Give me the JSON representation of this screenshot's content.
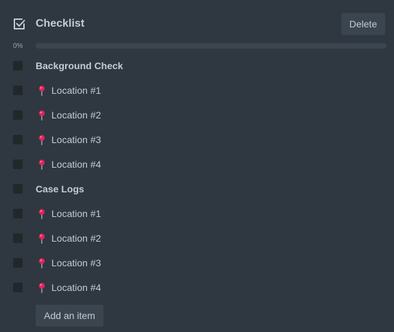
{
  "checklist": {
    "title": "Checklist",
    "title_icon": "checkbox-checked-icon",
    "delete_label": "Delete",
    "progress": {
      "label": "0%",
      "value": 0
    },
    "add_item_label": "Add an item",
    "item_icon": "round-pushpin-icon",
    "colors": {
      "background": "#2f3740",
      "button": "#3b4550",
      "checkbox": "#22272b",
      "text": "#c4ccd5",
      "pin": "#e0245e"
    },
    "items": [
      {
        "text": "Background Check",
        "heading": true
      },
      {
        "text": "Location #1",
        "heading": false
      },
      {
        "text": "Location #2",
        "heading": false
      },
      {
        "text": "Location #3",
        "heading": false
      },
      {
        "text": "Location #4",
        "heading": false
      },
      {
        "text": "Case Logs",
        "heading": true
      },
      {
        "text": "Location #1",
        "heading": false
      },
      {
        "text": "Location #2",
        "heading": false
      },
      {
        "text": "Location #3",
        "heading": false
      },
      {
        "text": "Location #4",
        "heading": false
      }
    ]
  }
}
